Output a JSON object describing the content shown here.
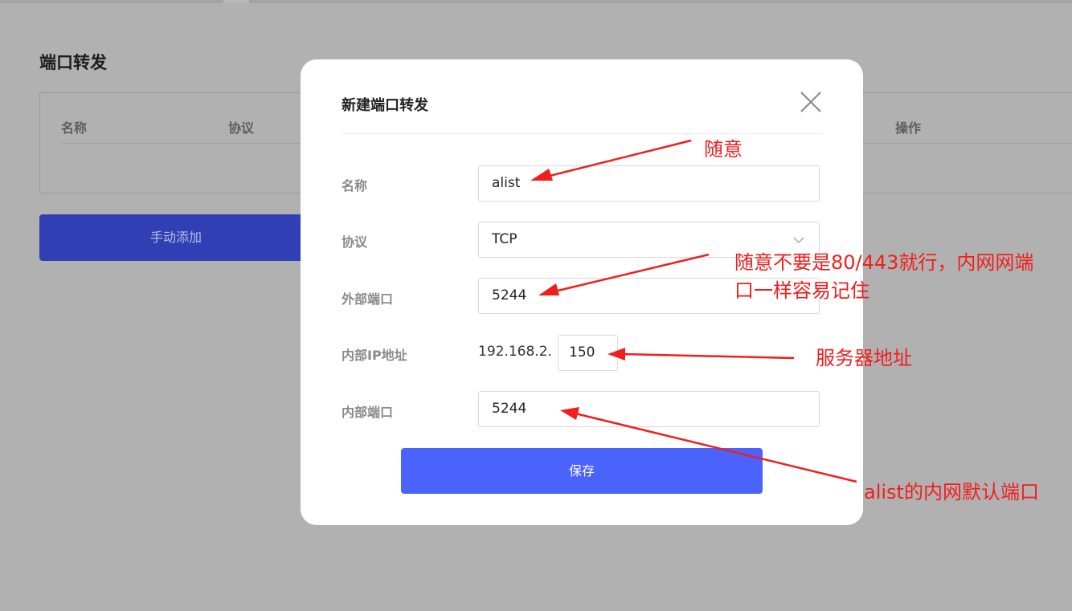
{
  "page": {
    "title": "端口转发",
    "table_headers": [
      "名称",
      "协议",
      "操作"
    ],
    "add_button": "手动添加"
  },
  "dialog": {
    "title": "新建端口转发",
    "fields": {
      "name": {
        "label": "名称",
        "value": "alist"
      },
      "protocol": {
        "label": "协议",
        "value": "TCP"
      },
      "external_port": {
        "label": "外部端口",
        "value": "5244"
      },
      "internal_ip": {
        "label": "内部IP地址",
        "prefix": "192.168.2.",
        "value": "150"
      },
      "internal_port": {
        "label": "内部端口",
        "value": "5244"
      }
    },
    "save_button": "保存"
  },
  "annotations": {
    "name_note": "随意",
    "port_note_line1": "随意不要是80/443就行，内网网端",
    "port_note_line2": "口一样容易记住",
    "ip_note": "服务器地址",
    "internal_port_note": "alist的内网默认端口",
    "color": "#f21d1d"
  },
  "colors": {
    "overlay": "#b1b1b1",
    "primary_button": "#4a63fd",
    "dimmed_button": "#3040b4"
  }
}
